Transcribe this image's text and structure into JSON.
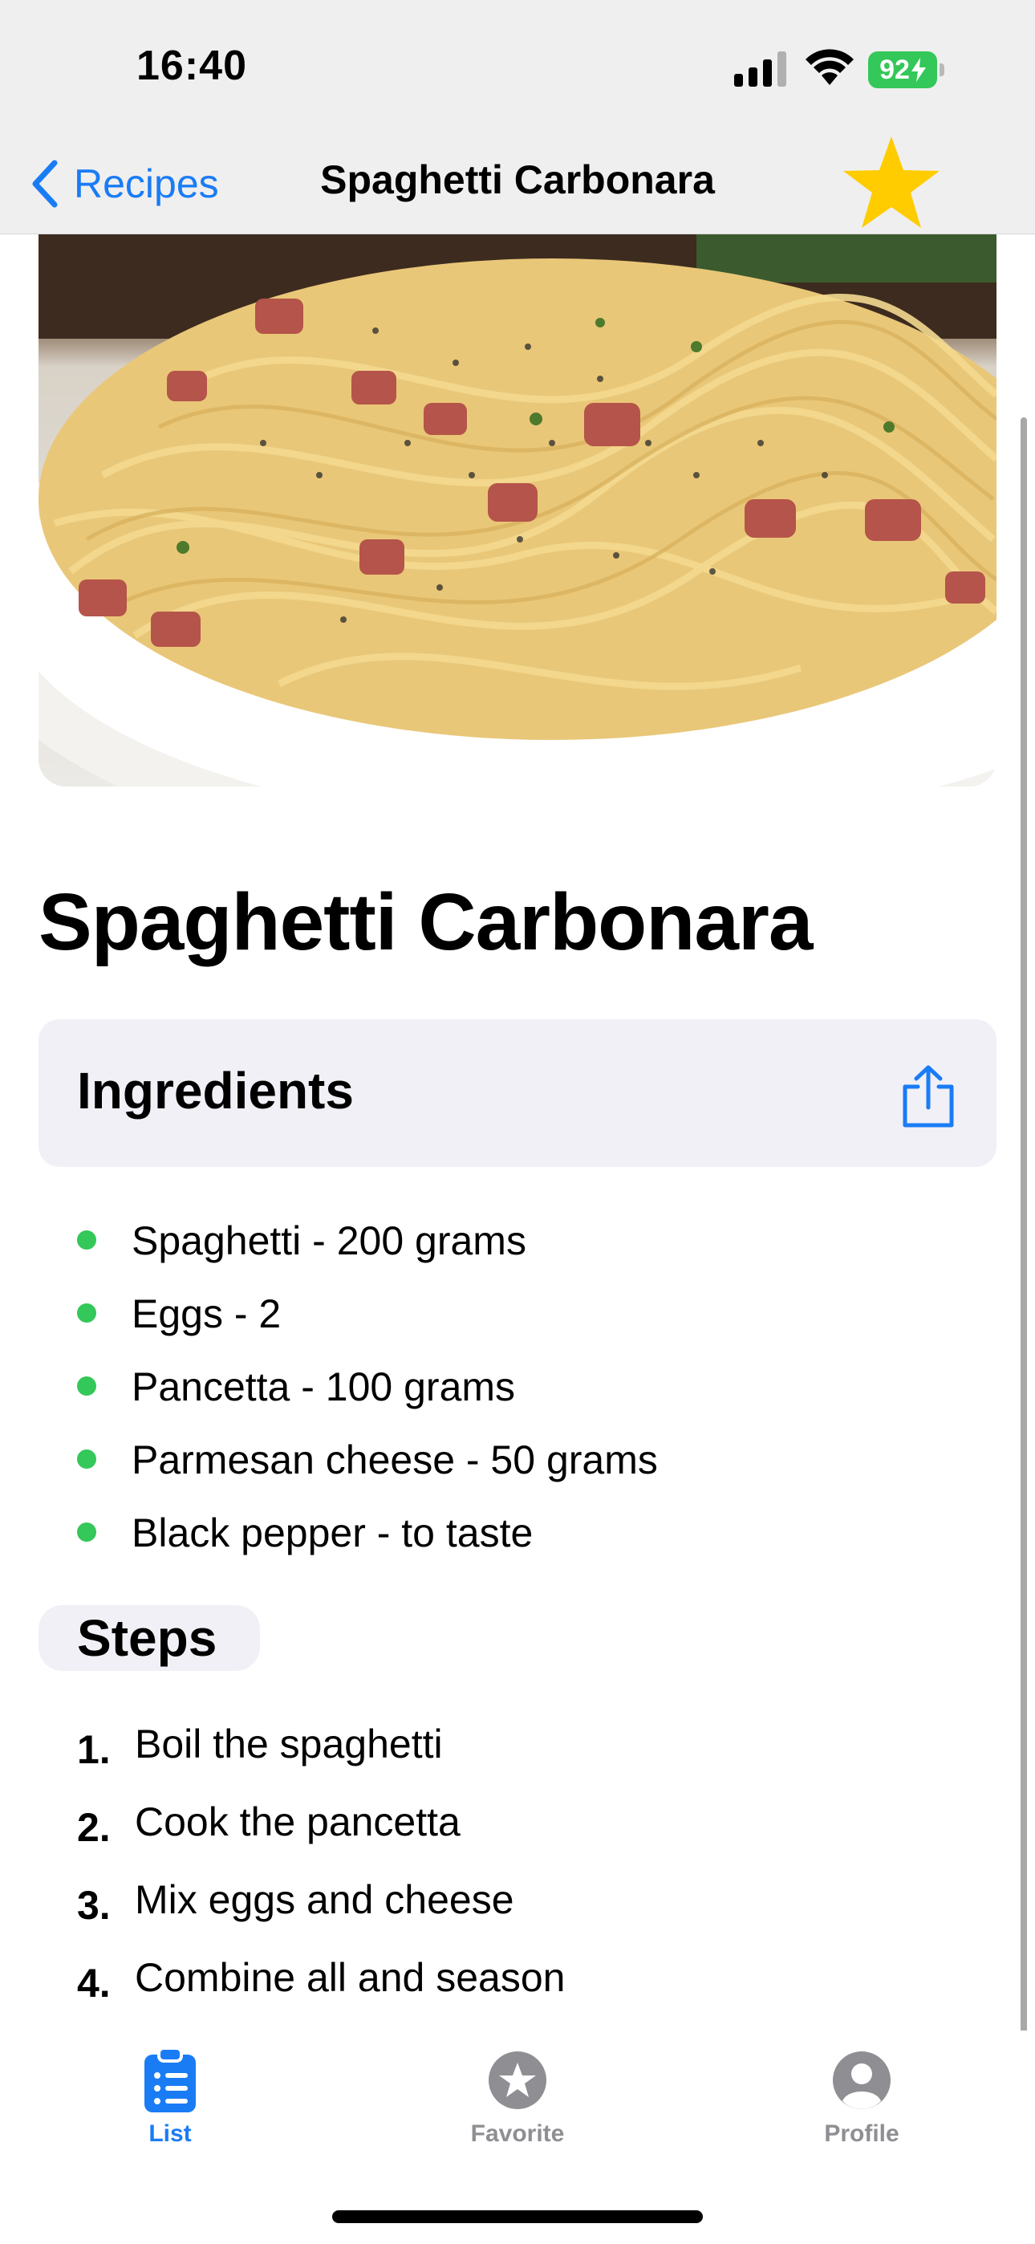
{
  "status_bar": {
    "time": "16:40",
    "battery": "92"
  },
  "nav": {
    "back_label": "Recipes",
    "title": "Spaghetti Carbonara"
  },
  "recipe": {
    "title": "Spaghetti Carbonara",
    "ingredients_heading": "Ingredients",
    "ingredients": [
      "Spaghetti - 200 grams",
      "Eggs - 2",
      "Pancetta - 100 grams",
      "Parmesan cheese - 50 grams",
      "Black pepper - to taste"
    ],
    "steps_heading": "Steps",
    "steps": [
      {
        "num": "1.",
        "text": "Boil the spaghetti"
      },
      {
        "num": "2.",
        "text": "Cook the pancetta"
      },
      {
        "num": "3.",
        "text": "Mix eggs and cheese"
      },
      {
        "num": "4.",
        "text": "Combine all and season"
      }
    ]
  },
  "tabbar": {
    "tabs": [
      {
        "label": "List",
        "icon": "clipboard-list-icon",
        "active": true
      },
      {
        "label": "Favorite",
        "icon": "star-circle-icon",
        "active": false
      },
      {
        "label": "Profile",
        "icon": "person-circle-icon",
        "active": false
      }
    ]
  },
  "colors": {
    "accent": "#1a7cf5",
    "favorite_star": "#ffcc00",
    "bullet": "#34c759",
    "battery": "#34c759",
    "section_bg": "#f0f0f6",
    "inactive_tab": "#8e8e93"
  }
}
